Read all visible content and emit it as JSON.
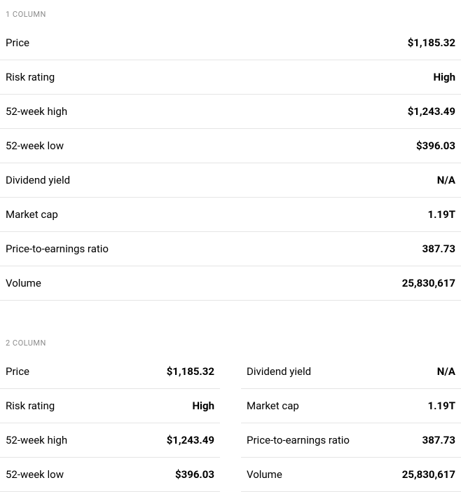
{
  "headers": {
    "one_column": "1 COLUMN",
    "two_column": "2 COLUMN"
  },
  "stats": {
    "price": {
      "label": "Price",
      "value": "$1,185.32"
    },
    "risk_rating": {
      "label": "Risk rating",
      "value": "High"
    },
    "week_high": {
      "label": "52-week high",
      "value": "$1,243.49"
    },
    "week_low": {
      "label": "52-week low",
      "value": "$396.03"
    },
    "dividend_yield": {
      "label": "Dividend yield",
      "value": "N/A"
    },
    "market_cap": {
      "label": "Market cap",
      "value": "1.19T"
    },
    "pe_ratio": {
      "label": "Price-to-earnings ratio",
      "value": "387.73"
    },
    "volume": {
      "label": "Volume",
      "value": "25,830,617"
    }
  }
}
